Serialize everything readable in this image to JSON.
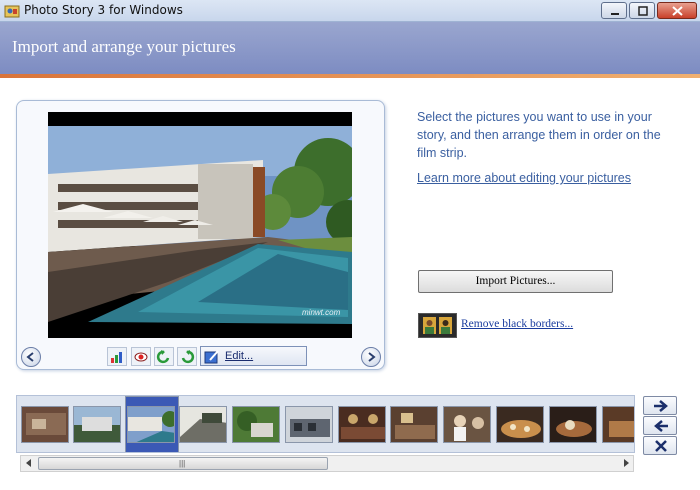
{
  "window": {
    "title": "Photo Story 3 for Windows",
    "accent_color": "#7d8cc2",
    "icons": {
      "app": "photo-story-icon",
      "minimize": "minimize-icon",
      "maximize": "maximize-icon",
      "close": "close-icon"
    }
  },
  "header": {
    "title": "Import and arrange your pictures"
  },
  "preview": {
    "watermark": "minwt.com",
    "toolbar": {
      "tools": [
        "auto-correct-icon",
        "red-eye-icon",
        "rotate-left-icon",
        "rotate-right-icon"
      ],
      "edit_label": "Edit..."
    }
  },
  "instructions": {
    "text": "Select the pictures you want to use in your story, and then arrange them in order on the film strip.",
    "learn_more": "Learn more about editing your pictures"
  },
  "actions": {
    "import_label": "Import Pictures...",
    "remove_borders_label": "Remove black borders..."
  },
  "filmstrip": {
    "selected_index": 2,
    "thumbnail_count": 12,
    "buttons": [
      "move-right-icon",
      "move-left-icon",
      "delete-icon"
    ]
  }
}
